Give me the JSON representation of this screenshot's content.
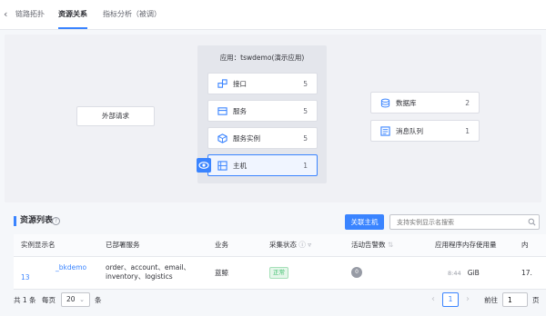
{
  "tabs": [
    {
      "label": "链路拓扑"
    },
    {
      "label": "资源关系"
    },
    {
      "label": "指标分析（被调）"
    }
  ],
  "topology": {
    "external_node": "外部请求",
    "app_title": "应用：tswdemo(演示应用)",
    "app_nodes": [
      {
        "label": "接口",
        "count": "5",
        "icon": "interface-icon"
      },
      {
        "label": "服务",
        "count": "5",
        "icon": "service-icon"
      },
      {
        "label": "服务实例",
        "count": "5",
        "icon": "instance-icon"
      },
      {
        "label": "主机",
        "count": "1",
        "icon": "host-icon"
      }
    ],
    "side_nodes": [
      {
        "label": "数据库",
        "count": "2",
        "icon": "database-icon"
      },
      {
        "label": "消息队列",
        "count": "1",
        "icon": "message-queue-icon"
      }
    ]
  },
  "list": {
    "title": "资源列表",
    "link_host_button": "关联主机",
    "search_placeholder": "支持实例显示名搜索",
    "columns": [
      "实例显示名",
      "已部署服务",
      "业务",
      "采集状态",
      "活动告警数",
      "应用程序内存使用量",
      "内"
    ],
    "rows": [
      {
        "instance": "_bkdemo",
        "instance_sub": "13",
        "services": "order、account、email、inventory、logistics",
        "business": "蓝鲸",
        "status": "正常",
        "alarms": "0",
        "mem_a": "8:44",
        "mem_b": "GiB",
        "extra": "17."
      }
    ]
  },
  "pager": {
    "total": "共 1 条",
    "per_page_label": "每页",
    "per_page": "20",
    "unit": "条",
    "current": "1",
    "goto_label": "前往",
    "goto_value": "1",
    "page_label": "页"
  },
  "colors": {
    "accent": "#3a84ff",
    "success": "#3fc06d"
  }
}
